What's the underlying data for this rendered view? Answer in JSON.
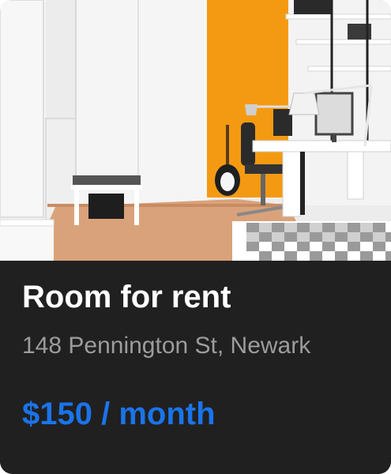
{
  "listing": {
    "image_alt": "Bright room with orange accent wall, desk, guitar and checkered bed",
    "title": "Room for rent",
    "address": "148 Pennington St, Newark",
    "price": "$150 / month"
  },
  "colors": {
    "card_background": "#202020",
    "title": "#ffffff",
    "address": "#9c9c9c",
    "price_accent": "#1a74ea",
    "wall_orange": "#f49a12"
  }
}
